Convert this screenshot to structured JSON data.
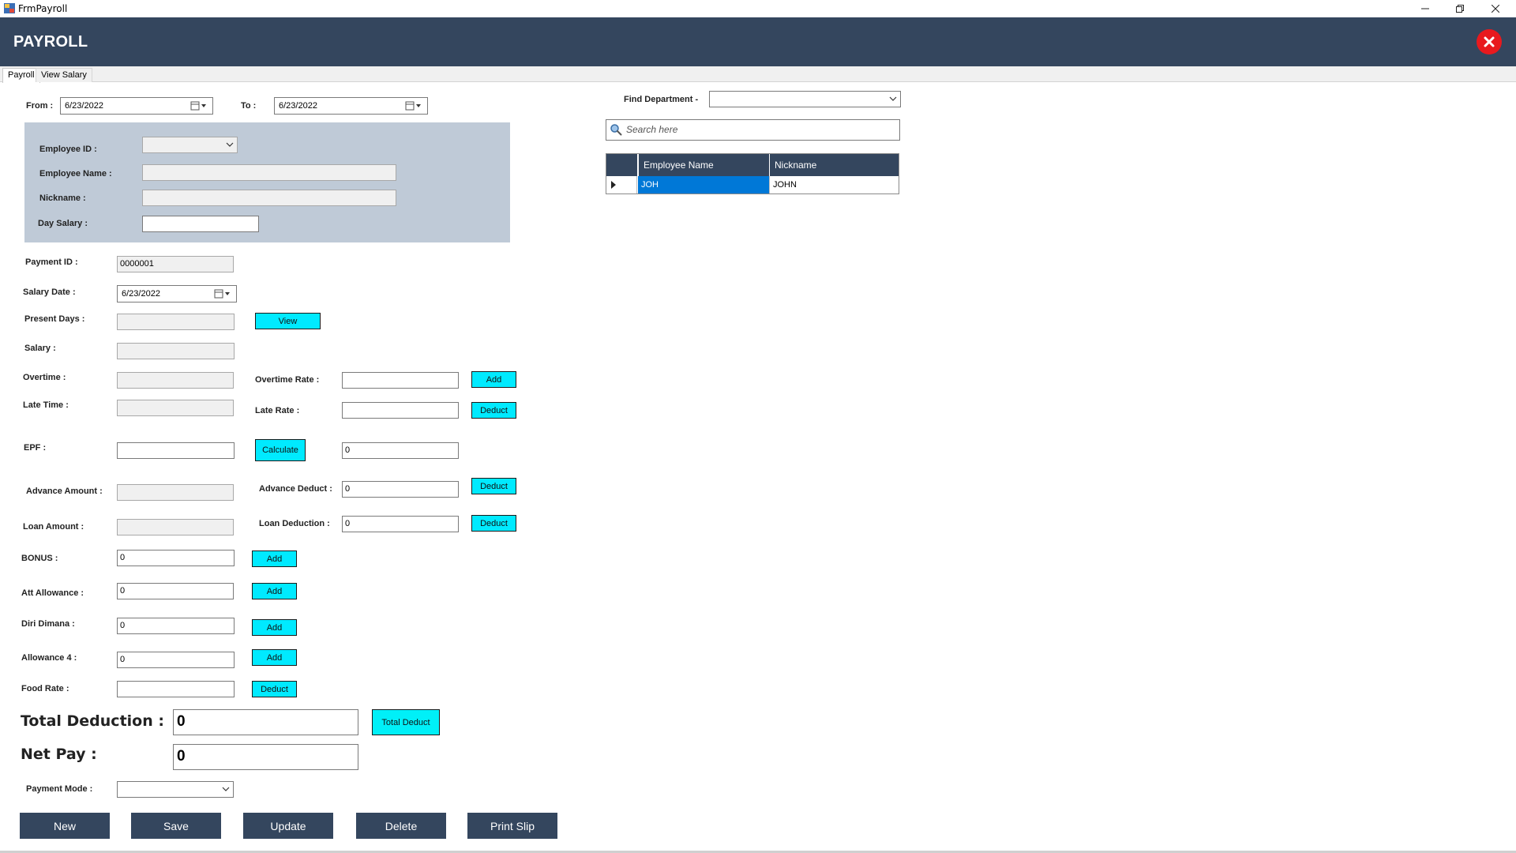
{
  "window": {
    "caption": "FrmPayroll",
    "header_title": "PAYROLL"
  },
  "tabs": [
    {
      "label": "Payroll",
      "active": true
    },
    {
      "label": "View Salary",
      "active": false
    }
  ],
  "date_range": {
    "from_label": "From :",
    "from_value": "6/23/2022",
    "to_label": "To :",
    "to_value": "6/23/2022"
  },
  "employee": {
    "id_label": "Employee ID :",
    "id_value": "",
    "name_label": "Employee Name :",
    "name_value": "",
    "nickname_label": "Nickname :",
    "nickname_value": "",
    "day_salary_label": "Day Salary :",
    "day_salary_value": ""
  },
  "payment": {
    "payment_id_label": "Payment ID :",
    "payment_id_value": "0000001",
    "salary_date_label": "Salary Date :",
    "salary_date_value": "6/23/2022",
    "present_days_label": "Present Days :",
    "present_days_value": "",
    "view_label": "View",
    "salary_label": "Salary :",
    "salary_value": "",
    "overtime_label": "Overtime :",
    "overtime_value": "",
    "overtime_rate_label": "Overtime Rate :",
    "overtime_rate_value": "",
    "overtime_add_label": "Add",
    "late_time_label": "Late Time :",
    "late_time_value": "",
    "late_rate_label": "Late Rate :",
    "late_rate_value": "",
    "late_deduct_label": "Deduct",
    "epf_label": "EPF :",
    "epf_value": "",
    "calculate_label": "Calculate",
    "epf_result_value": "0",
    "advance_amount_label": "Advance Amount :",
    "advance_amount_value": "",
    "advance_deduct_label": "Advance Deduct :",
    "advance_deduct_value": "0",
    "advance_deduct_btn": "Deduct",
    "loan_amount_label": "Loan Amount :",
    "loan_amount_value": "",
    "loan_deduction_label": "Loan Deduction :",
    "loan_deduction_value": "0",
    "loan_deduct_btn": "Deduct",
    "bonus_label": "BONUS :",
    "bonus_value": "0",
    "bonus_add": "Add",
    "att_allowance_label": "Att Allowance :",
    "att_allowance_value": "0",
    "att_allowance_add": "Add",
    "diri_dimana_label": "Diri Dimana :",
    "diri_dimana_value": "0",
    "diri_dimana_add": "Add",
    "allowance4_label": "Allowance 4 :",
    "allowance4_value": "0",
    "allowance4_add": "Add",
    "food_rate_label": "Food Rate :",
    "food_rate_value": "",
    "food_rate_deduct": "Deduct",
    "total_deduction_label": "Total Deduction :",
    "total_deduction_value": "0",
    "total_deduct_btn": "Total Deduct",
    "net_pay_label": "Net Pay :",
    "net_pay_value": "0",
    "payment_mode_label": "Payment Mode :",
    "payment_mode_value": ""
  },
  "actions": {
    "new": "New",
    "save": "Save",
    "update": "Update",
    "delete": "Delete",
    "print_slip": "Print Slip"
  },
  "finder": {
    "department_label": "Find Department -",
    "department_value": "",
    "search_placeholder": "Search here",
    "columns": [
      "Employee Name",
      "Nickname"
    ],
    "rows": [
      {
        "employee_name": "JOH",
        "nickname": "JOHN"
      }
    ]
  },
  "colors": {
    "header": "#34465e",
    "accent_button": "#00eaff",
    "panel": "#bfcad7",
    "selected_cell": "#0078d7",
    "close": "#e8191e"
  }
}
